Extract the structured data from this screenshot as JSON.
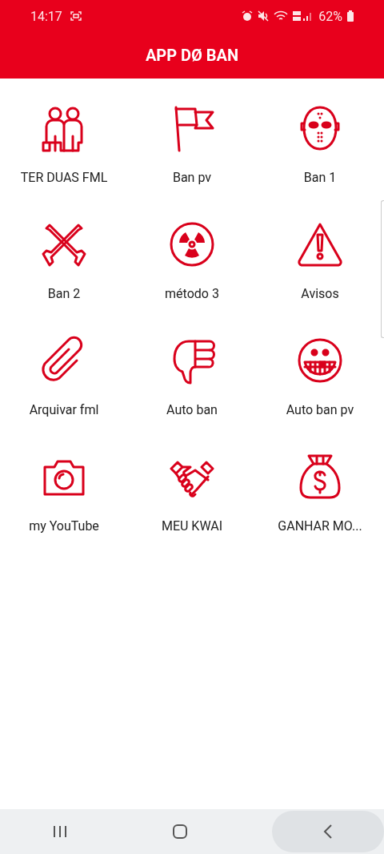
{
  "status_bar": {
    "time": "14:17",
    "battery": "62%"
  },
  "app_bar": {
    "title": "APP DØ BAN"
  },
  "grid": [
    {
      "label": "TER DUAS FML"
    },
    {
      "label": "Ban pv"
    },
    {
      "label": "Ban 1"
    },
    {
      "label": "Ban 2"
    },
    {
      "label": "método 3"
    },
    {
      "label": "Avisos"
    },
    {
      "label": "Arquivar fml"
    },
    {
      "label": "Auto ban"
    },
    {
      "label": "Auto ban pv"
    },
    {
      "label": "my YouTube"
    },
    {
      "label": "MEU KWAI"
    },
    {
      "label": "GANHAR MO..."
    }
  ]
}
